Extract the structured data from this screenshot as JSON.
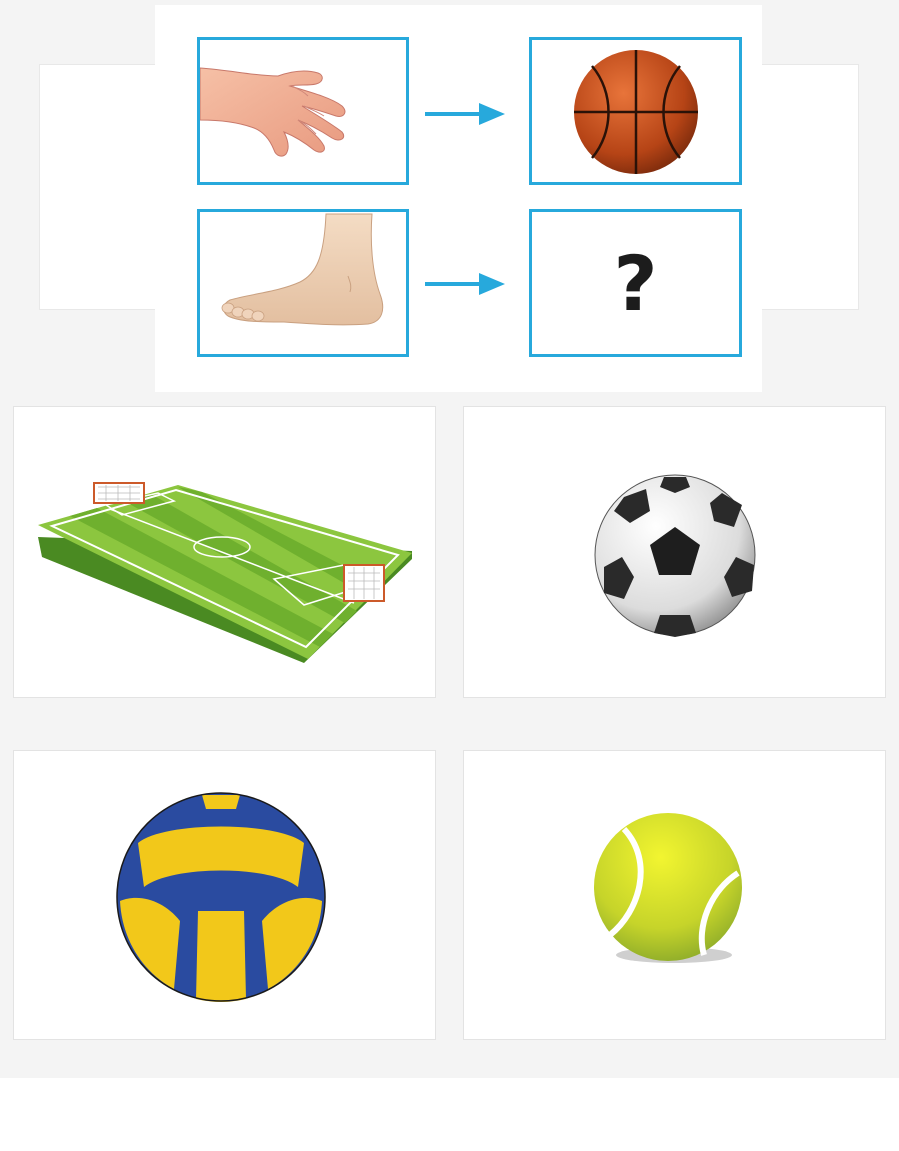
{
  "question": {
    "rows": [
      {
        "left_icon": "hand-icon",
        "right_icon": "basketball-icon",
        "answer": ""
      },
      {
        "left_icon": "foot-icon",
        "right_icon": "",
        "answer": "?"
      }
    ],
    "arrow_icon": "arrow-right-icon",
    "colors": {
      "frame": "#27a9dc",
      "arrow": "#27a9dc"
    }
  },
  "options": [
    {
      "icon": "soccer-field-icon"
    },
    {
      "icon": "soccer-ball-icon"
    },
    {
      "icon": "volleyball-icon"
    },
    {
      "icon": "tennis-ball-icon"
    }
  ]
}
